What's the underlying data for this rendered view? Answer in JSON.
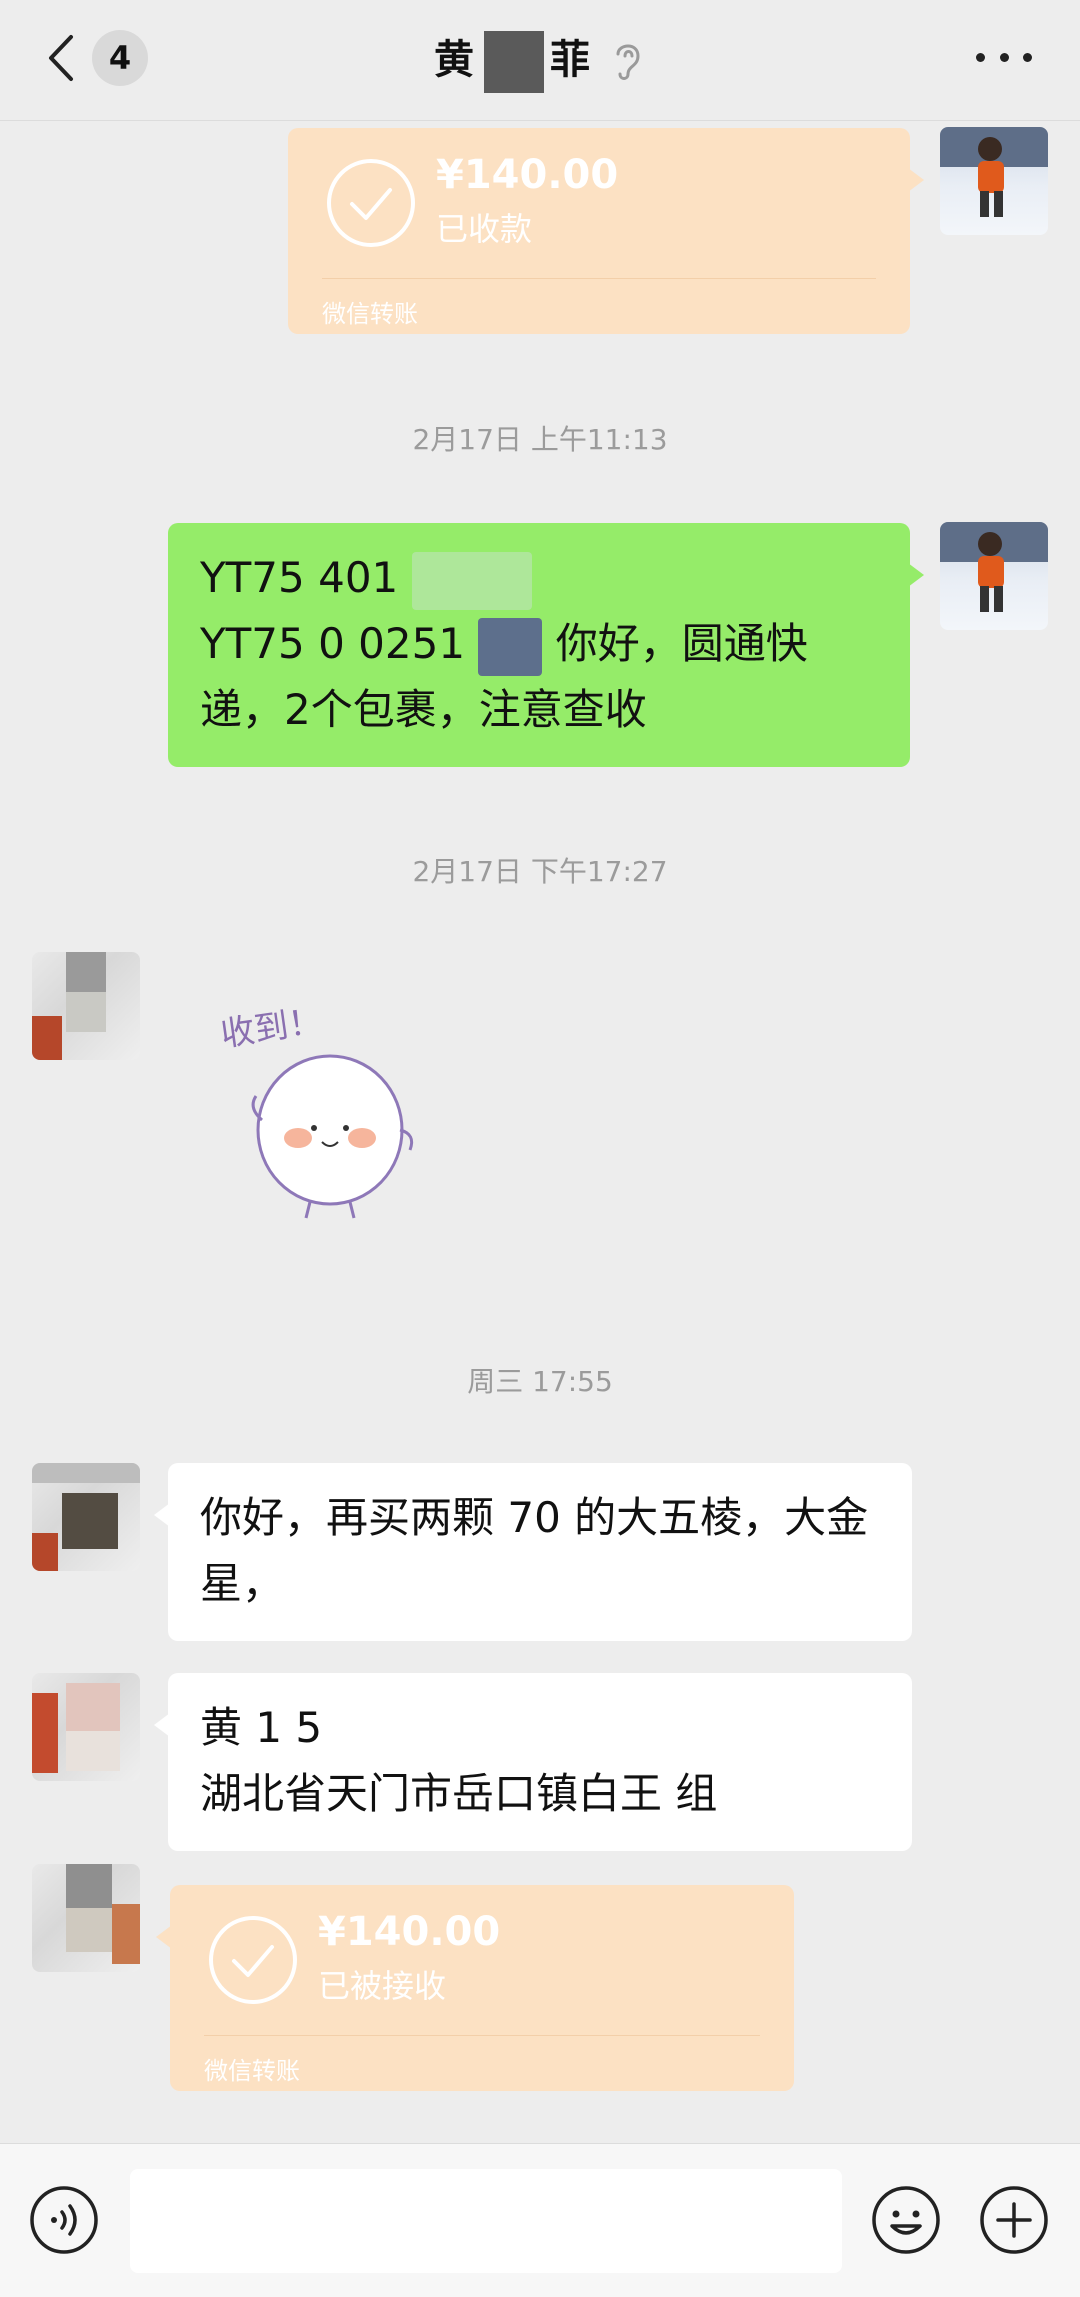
{
  "header": {
    "back_count": "4",
    "title_start": "黄",
    "title_end": "菲"
  },
  "messages": {
    "transfer_1": {
      "amount": "¥140.00",
      "status": "已收款",
      "label": "微信转账"
    },
    "time_1": "2月17日 上午11:13",
    "tracking_line1": "YT75 401 ",
    "tracking_line2": "YT75 0 0251",
    "tracking_text": "你好，圆通快递，2个包裹，注意查收",
    "time_2": "2月17日 下午17:27",
    "sticker_text": "收到！",
    "time_3": "周三 17:55",
    "order_text": "你好，再买两颗 70 的大五棱，大金星，",
    "address_line1": "黄 1 5",
    "address_line2": "湖北省天门市岳口镇白王 组",
    "transfer_2": {
      "amount": "¥140.00",
      "status": "已被接收",
      "label": "微信转账"
    }
  },
  "input": {
    "placeholder": ""
  },
  "colors": {
    "background": "#ededed",
    "green_bubble": "#95ec69",
    "white_bubble": "#ffffff",
    "transfer_card": "#fce1c3"
  },
  "icons": [
    "back-chevron-icon",
    "ear-icon",
    "more-icon",
    "check-circle-icon",
    "voice-icon",
    "emoji-icon",
    "plus-icon"
  ]
}
